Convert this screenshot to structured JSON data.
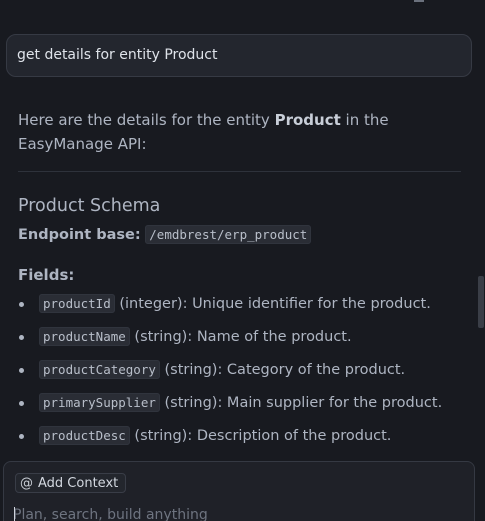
{
  "query": {
    "text": "get details for entity Product"
  },
  "response": {
    "intro_prefix": "Here are the details for the entity ",
    "intro_bold": "Product",
    "intro_suffix": " in the EasyManage API:",
    "schema_title": "Product Schema",
    "endpoint_label": "Endpoint base:",
    "endpoint_value": "/emdbrest/erp_product",
    "fields_title": "Fields:",
    "fields": [
      {
        "name": "productId",
        "description": "(integer): Unique identifier for the product."
      },
      {
        "name": "productName",
        "description": "(string): Name of the product."
      },
      {
        "name": "productCategory",
        "description": "(string): Category of the product."
      },
      {
        "name": "primarySupplier",
        "description": "(string): Main supplier for the product."
      },
      {
        "name": "productDesc",
        "description": "(string): Description of the product."
      }
    ]
  },
  "composer": {
    "add_context_label": "Add Context",
    "add_context_icon": "at-icon",
    "placeholder": "Plan, search, build anything"
  }
}
